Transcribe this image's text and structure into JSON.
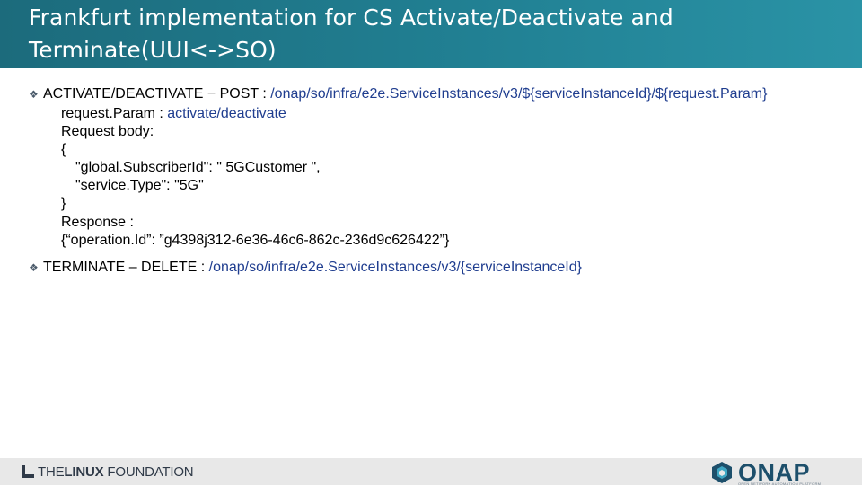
{
  "slide": {
    "title": "Frankfurt implementation for CS Activate/Deactivate and Terminate(UUI<->SO)"
  },
  "bullets": {
    "activate": {
      "label": "ACTIVATE/DEACTIVATE − POST : ",
      "path": "/onap/so/infra/e2e.ServiceInstances/v3/${serviceInstanceId}/${request.Param}",
      "request_param_label": "request.Param : ",
      "request_param_value": "activate/deactivate",
      "request_body_label": "Request body:",
      "brace_open": "{",
      "subscriber_line": "\"global.SubscriberId\": \" 5GCustomer \",",
      "service_type_line": "\"service.Type\": \"5G\"",
      "brace_close": "}",
      "response_label": "Response :",
      "response_body": "{“operation.Id”: ”g4398j312-6e36-46c6-862c-236d9c626422”}"
    },
    "terminate": {
      "label": "TERMINATE – DELETE : ",
      "path": "/onap/so/infra/e2e.ServiceInstances/v3/{serviceInstanceId}"
    }
  },
  "footer": {
    "left_logo_text_1": "THE",
    "left_logo_text_2": "LINUX",
    "left_logo_text_3": " FOUNDATION",
    "right_logo_text": "ONAP",
    "right_logo_subtitle": "OPEN NETWORK AUTOMATION PLATFORM"
  },
  "colors": {
    "title_bar": "#218093",
    "link_blue": "#1f3d8f",
    "footer_bg": "#e8e8e8"
  }
}
